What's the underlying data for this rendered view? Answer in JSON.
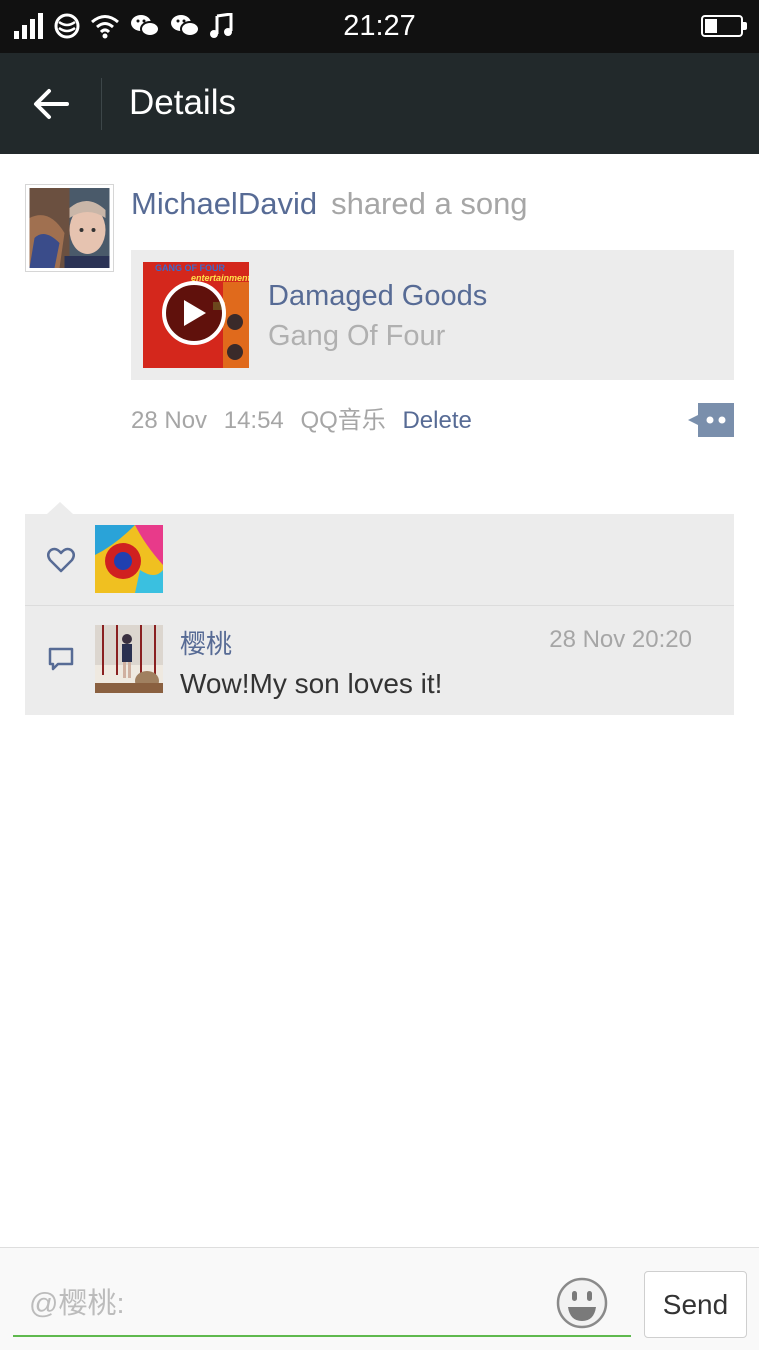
{
  "status_bar": {
    "time": "21:27",
    "battery_level": 0.35,
    "icons": [
      "signal-icon",
      "carrier-icon",
      "wifi-icon",
      "wechat-icon",
      "wechat-icon",
      "music-note-icon",
      "battery-icon"
    ]
  },
  "nav": {
    "back_icon": "arrow-left-icon",
    "title": "Details"
  },
  "post": {
    "user": "MichaelDavid",
    "action": "shared a song",
    "song": {
      "title": "Damaged Goods",
      "artist": "Gang Of Four",
      "album_art_text_top": "GANG OF FOUR",
      "album_art_text_sub": "entertainment!"
    },
    "date": "28 Nov",
    "time": "14:54",
    "source": "QQ音乐",
    "delete_label": "Delete"
  },
  "likes": {
    "icon": "heart-icon"
  },
  "comments": [
    {
      "name": "樱桃",
      "time": "28 Nov  20:20",
      "text": "Wow!My son loves it!"
    }
  ],
  "input": {
    "placeholder": "@樱桃:",
    "send_label": "Send"
  },
  "colors": {
    "link": "#576b95",
    "nav_bg": "#22292b",
    "accent_green": "#5fb94e",
    "card_bg": "#ececec"
  }
}
